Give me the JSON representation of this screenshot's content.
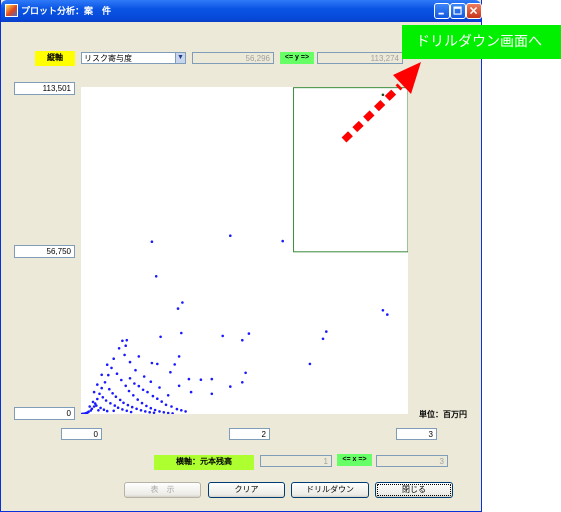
{
  "window": {
    "title": "プロット分析：案　件"
  },
  "y_axis": {
    "tag": "縦軸",
    "metric_select": "リスク寄与度",
    "range_from": "56,296",
    "range_between": "<= y =>",
    "range_to": "113,274",
    "tick_max": "113,501",
    "tick_mid": "56,750",
    "tick_min": "0"
  },
  "x_axis": {
    "tag": "横軸：元本残高",
    "tick_min": "0",
    "tick_mid": "2",
    "tick_max": "3",
    "range_from": "1",
    "range_between": "<= x =>",
    "range_to": "3"
  },
  "unit_label": "単位：百万円",
  "buttons": {
    "show": "表　示",
    "clear": "クリア",
    "drilldown": "ドリルダウン",
    "close": "閉じる"
  },
  "annotation": {
    "callout": "ドリルダウン画面へ"
  },
  "colors": {
    "point": "#1a1aff",
    "selection": "#3a8a3a",
    "callout_bg": "#00f000",
    "arrow": "#ff0000",
    "y_tag": "#ffff00",
    "x_tag": "#adff2f",
    "between_tag": "#66ff66"
  },
  "chart_data": {
    "type": "scatter",
    "xlim": [
      0,
      3
    ],
    "ylim": [
      0,
      113501
    ],
    "selection": {
      "x": [
        1.95,
        3.0
      ],
      "y": [
        56296,
        113274
      ]
    },
    "series": [
      {
        "points": [
          [
            2.77,
            110800
          ],
          [
            1.85,
            60000
          ],
          [
            1.37,
            61900
          ],
          [
            0.65,
            59800
          ],
          [
            0.69,
            47800
          ],
          [
            0.89,
            36600
          ],
          [
            0.93,
            38700
          ],
          [
            2.77,
            36000
          ],
          [
            2.81,
            34500
          ],
          [
            0.92,
            28100
          ],
          [
            1.3,
            27100
          ],
          [
            1.54,
            27900
          ],
          [
            2.22,
            26100
          ],
          [
            0.73,
            26800
          ],
          [
            2.25,
            28600
          ],
          [
            1.48,
            25600
          ],
          [
            0.42,
            25600
          ],
          [
            0.38,
            25400
          ],
          [
            0.53,
            20000
          ],
          [
            0.65,
            17700
          ],
          [
            0.7,
            17400
          ],
          [
            0.86,
            17200
          ],
          [
            0.9,
            20000
          ],
          [
            2.1,
            17400
          ],
          [
            0.82,
            14500
          ],
          [
            1.51,
            14300
          ],
          [
            0.99,
            12100
          ],
          [
            1.1,
            11900
          ],
          [
            1.2,
            12100
          ],
          [
            1.48,
            11000
          ],
          [
            0.9,
            9800
          ],
          [
            1.37,
            9500
          ],
          [
            1.01,
            7600
          ],
          [
            1.2,
            7000
          ],
          [
            0.8,
            6500
          ],
          [
            0.72,
            9200
          ],
          [
            0.64,
            11200
          ],
          [
            0.58,
            13000
          ],
          [
            0.5,
            15200
          ],
          [
            0.45,
            18000
          ],
          [
            0.4,
            20500
          ],
          [
            0.35,
            22800
          ],
          [
            0.3,
            19200
          ],
          [
            0.28,
            16000
          ],
          [
            0.25,
            13500
          ],
          [
            0.22,
            11000
          ],
          [
            0.19,
            9000
          ],
          [
            0.17,
            7000
          ],
          [
            0.15,
            5200
          ],
          [
            0.13,
            3600
          ],
          [
            0.12,
            2600
          ],
          [
            0.1,
            1800
          ],
          [
            0.09,
            1200
          ],
          [
            0.07,
            800
          ],
          [
            0.06,
            500
          ],
          [
            0.05,
            300
          ],
          [
            0.04,
            200
          ],
          [
            0.03,
            120
          ],
          [
            0.02,
            60
          ],
          [
            0.01,
            20
          ],
          [
            0.33,
            14000
          ],
          [
            0.37,
            11800
          ],
          [
            0.41,
            9800
          ],
          [
            0.44,
            8000
          ],
          [
            0.48,
            6500
          ],
          [
            0.52,
            5000
          ],
          [
            0.56,
            3800
          ],
          [
            0.6,
            2800
          ],
          [
            0.64,
            2000
          ],
          [
            0.68,
            1400
          ],
          [
            0.72,
            900
          ],
          [
            0.76,
            600
          ],
          [
            0.8,
            350
          ],
          [
            0.84,
            200
          ],
          [
            0.26,
            8600
          ],
          [
            0.29,
            7200
          ],
          [
            0.32,
            6000
          ],
          [
            0.36,
            4900
          ],
          [
            0.39,
            3900
          ],
          [
            0.43,
            3100
          ],
          [
            0.47,
            2400
          ],
          [
            0.51,
            1800
          ],
          [
            0.55,
            1300
          ],
          [
            0.59,
            900
          ],
          [
            0.63,
            600
          ],
          [
            0.67,
            400
          ],
          [
            0.2,
            5800
          ],
          [
            0.23,
            4700
          ],
          [
            0.27,
            3700
          ],
          [
            0.31,
            2900
          ],
          [
            0.34,
            2200
          ],
          [
            0.38,
            1600
          ],
          [
            0.42,
            1100
          ],
          [
            0.46,
            700
          ],
          [
            0.11,
            4200
          ],
          [
            0.14,
            2900
          ],
          [
            0.18,
            2100
          ],
          [
            0.21,
            1500
          ],
          [
            0.24,
            1000
          ],
          [
            0.08,
            2600
          ],
          [
            0.16,
            1300
          ],
          [
            0.3,
            1100
          ],
          [
            0.53,
            9700
          ],
          [
            0.61,
            7600
          ],
          [
            0.7,
            5300
          ],
          [
            0.78,
            3200
          ],
          [
            0.88,
            1700
          ],
          [
            0.96,
            900
          ],
          [
            0.24,
            17100
          ],
          [
            0.19,
            13600
          ],
          [
            0.15,
            10200
          ],
          [
            0.12,
            7600
          ],
          [
            0.45,
            12400
          ],
          [
            0.49,
            10600
          ],
          [
            0.57,
            8400
          ],
          [
            0.66,
            6200
          ],
          [
            0.74,
            4300
          ],
          [
            0.83,
            2600
          ],
          [
            0.92,
            1300
          ],
          [
            0.41,
            23700
          ]
        ]
      }
    ]
  }
}
